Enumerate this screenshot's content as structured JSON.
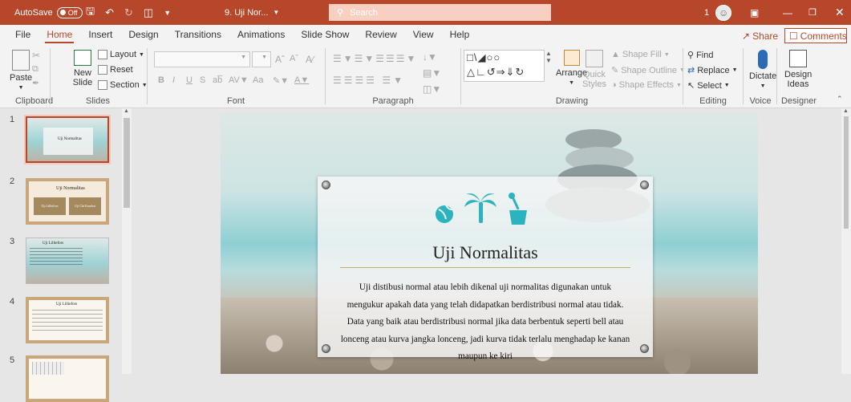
{
  "titlebar": {
    "autosave_label": "AutoSave",
    "autosave_state": "Off",
    "filename": "9. Uji Nor...",
    "search_placeholder": "Search",
    "notification_count": "1"
  },
  "menu": {
    "tabs": [
      "File",
      "Home",
      "Insert",
      "Design",
      "Transitions",
      "Animations",
      "Slide Show",
      "Review",
      "View",
      "Help"
    ],
    "active_tab": "Home",
    "share_label": "Share",
    "comments_label": "Comments"
  },
  "ribbon": {
    "clipboard": {
      "paste": "Paste",
      "group": "Clipboard"
    },
    "slides": {
      "new_slide": "New Slide",
      "layout": "Layout",
      "reset": "Reset",
      "section": "Section",
      "group": "Slides"
    },
    "font": {
      "group": "Font",
      "bold": "B",
      "italic": "I",
      "underline": "U",
      "strike": "S",
      "case": "Aa"
    },
    "paragraph": {
      "group": "Paragraph"
    },
    "drawing": {
      "arrange": "Arrange",
      "quick_styles": "Quick Styles",
      "shape_fill": "Shape Fill",
      "shape_outline": "Shape Outline",
      "shape_effects": "Shape Effects",
      "group": "Drawing"
    },
    "editing": {
      "find": "Find",
      "replace": "Replace",
      "select": "Select",
      "group": "Editing"
    },
    "voice": {
      "dictate": "Dictate",
      "group": "Voice"
    },
    "designer": {
      "design_ideas": "Design Ideas",
      "group": "Designer"
    }
  },
  "thumbnails": [
    {
      "number": "1",
      "title": "Uji Normalitas"
    },
    {
      "number": "2",
      "title": "Uji Normalitas",
      "btn1": "Uji Lilliefors",
      "btn2": "Uji Chi Kuadrat"
    },
    {
      "number": "3",
      "title": "Uji Lilliefors"
    },
    {
      "number": "4",
      "title": "Uji Lilliefors"
    },
    {
      "number": "5",
      "title": ""
    }
  ],
  "slide": {
    "title": "Uji Normalitas",
    "body": "Uji distibusi normal atau lebih dikenal uji normalitas digunakan untuk mengukur apakah data yang telah didapatkan berdistribusi normal atau tidak. Data yang baik atau berdistribusi normal jika data berbentuk seperti bell atau lonceng atau kurva jangka lonceng, jadi kurva tidak terlalu menghadap ke kanan maupun ke kiri",
    "accent_color": "#2bb3c0"
  },
  "colors": {
    "accent": "#b7472a",
    "titlebar": "#b7472a"
  }
}
